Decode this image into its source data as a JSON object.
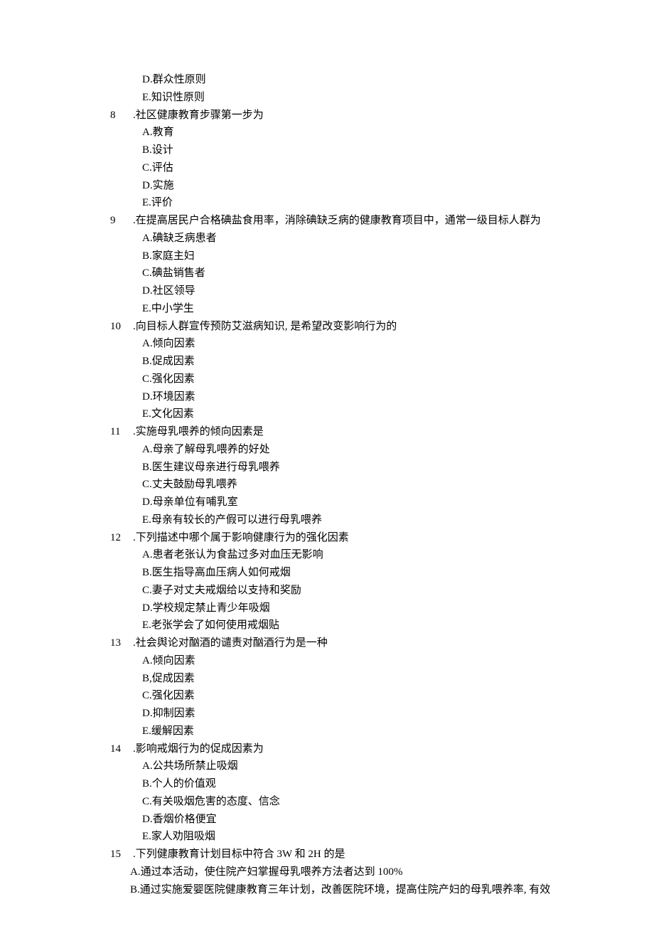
{
  "lines": [
    {
      "type": "option",
      "text": "D.群众性原则"
    },
    {
      "type": "option",
      "text": "E.知识性原则"
    },
    {
      "type": "question",
      "number": "8",
      "text": ".社区健康教育步骤第一步为"
    },
    {
      "type": "option",
      "text": "A.教育"
    },
    {
      "type": "option",
      "text": "B.设计"
    },
    {
      "type": "option",
      "text": "C.评估"
    },
    {
      "type": "option",
      "text": "D.实施"
    },
    {
      "type": "option",
      "text": "E.评价"
    },
    {
      "type": "question",
      "number": "9",
      "text": ".在提高居民户合格碘盐食用率，消除碘缺乏病的健康教育项目中，通常一级目标人群为"
    },
    {
      "type": "option",
      "text": "A.碘缺乏病患者"
    },
    {
      "type": "option",
      "text": "B.家庭主妇"
    },
    {
      "type": "option",
      "text": "C.碘盐销售者"
    },
    {
      "type": "option",
      "text": "D.社区领导"
    },
    {
      "type": "option",
      "text": "E.中小学生"
    },
    {
      "type": "question",
      "number": "10",
      "text": ".向目标人群宣传预防艾滋病知识, 是希望改变影响行为的"
    },
    {
      "type": "option",
      "text": "A.倾向因素"
    },
    {
      "type": "option",
      "text": "B.促成因素"
    },
    {
      "type": "option",
      "text": "C.强化因素"
    },
    {
      "type": "option",
      "text": "D.环境因素"
    },
    {
      "type": "option",
      "text": "E.文化因素"
    },
    {
      "type": "question",
      "number": "11",
      "text": ".实施母乳喂养的倾向因素是"
    },
    {
      "type": "option",
      "text": "A.母亲了解母乳喂养的好处"
    },
    {
      "type": "option",
      "text": "B.医生建议母亲进行母乳喂养"
    },
    {
      "type": "option",
      "text": "C.丈夫鼓励母乳喂养"
    },
    {
      "type": "option",
      "text": "D.母亲单位有哺乳室"
    },
    {
      "type": "option",
      "text": "E.母亲有较长的产假可以进行母乳喂养"
    },
    {
      "type": "question",
      "number": "12",
      "text": ".下列描述中哪个属于影响健康行为的强化因素"
    },
    {
      "type": "option",
      "text": "A.患者老张认为食盐过多对血压无影响"
    },
    {
      "type": "option",
      "text": "B.医生指导高血压病人如何戒烟"
    },
    {
      "type": "option",
      "text": "C.妻子对丈夫戒烟给以支持和奖励"
    },
    {
      "type": "option",
      "text": "D.学校规定禁止青少年吸烟"
    },
    {
      "type": "option",
      "text": "E.老张学会了如何使用戒烟贴"
    },
    {
      "type": "question",
      "number": "13",
      "text": ".社会舆论对酗酒的谴责对酗酒行为是一种"
    },
    {
      "type": "option",
      "text": "A.倾向因素"
    },
    {
      "type": "option",
      "text": "B,促成因素"
    },
    {
      "type": "option",
      "text": "C.强化因素"
    },
    {
      "type": "option",
      "text": "D.抑制因素"
    },
    {
      "type": "option",
      "text": "E.缓解因素"
    },
    {
      "type": "question",
      "number": "14",
      "text": ".影响戒烟行为的促成因素为"
    },
    {
      "type": "option",
      "text": " A.公共场所禁止吸烟"
    },
    {
      "type": "option",
      "text": " B.个人的价值观"
    },
    {
      "type": "option",
      "text": "C.有关吸烟危害的态度、信念"
    },
    {
      "type": "option",
      "text": "D.香烟价格便宜"
    },
    {
      "type": "option",
      "text": "E.家人劝阻吸烟"
    },
    {
      "type": "question",
      "number": "15",
      "text": ".下列健康教育计划目标中符合 3W 和 2H 的是"
    },
    {
      "type": "trailing",
      "text": "A.通过本活动，使住院产妇掌握母乳喂养方法者达到 100%"
    },
    {
      "type": "trailing",
      "text": "B.通过实施爱婴医院健康教育三年计划，改善医院环境，提高住院产妇的母乳喂养率, 有效"
    }
  ]
}
